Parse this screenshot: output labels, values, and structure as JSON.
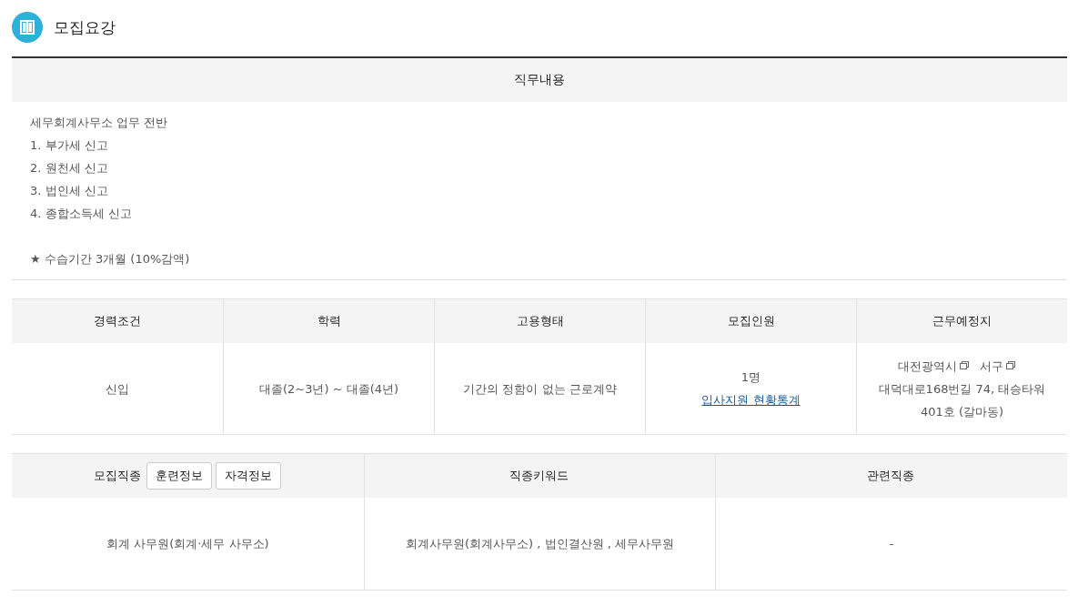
{
  "section_title": "모집요강",
  "duties": {
    "heading": "직무내용",
    "lines": [
      "세무회계사무소 업무 전반",
      "1. 부가세 신고",
      "2. 원천세 신고",
      "3. 법인세 신고",
      "4. 종합소득세 신고",
      "★  수습기간 3개월 (10%감액)"
    ]
  },
  "conditions": {
    "columns": [
      "경력조건",
      "학력",
      "고용형태",
      "모집인원",
      "근무예정지"
    ],
    "cells": [
      {
        "kind": "text",
        "lines": [
          "신입"
        ]
      },
      {
        "kind": "text",
        "lines": [
          "대졸(2~3년) ~ 대졸(4년)"
        ]
      },
      {
        "kind": "text",
        "lines": [
          "기간의 정함이 없는 근로계약"
        ]
      },
      {
        "kind": "count",
        "lines": [
          "1명"
        ],
        "link": "입사지원 현황통계"
      },
      {
        "kind": "address",
        "parts": [
          {
            "text": "대전광역시",
            "popup": true
          },
          {
            "text": "서구",
            "popup": true
          },
          {
            "text": "대덕대로168번길 74, 태승타워 401호 (갈마동)",
            "popup": false
          }
        ]
      }
    ]
  },
  "occupation": {
    "columns": [
      {
        "label": "모집직종",
        "buttons": [
          "훈련정보",
          "자격정보"
        ]
      },
      {
        "label": "직종키워드"
      },
      {
        "label": "관련직종"
      }
    ],
    "cells": [
      "회계 사무원(회계·세무 사무소)",
      "회계사무원(회계사무소) , 법인결산원 , 세무사무원",
      "-"
    ]
  }
}
